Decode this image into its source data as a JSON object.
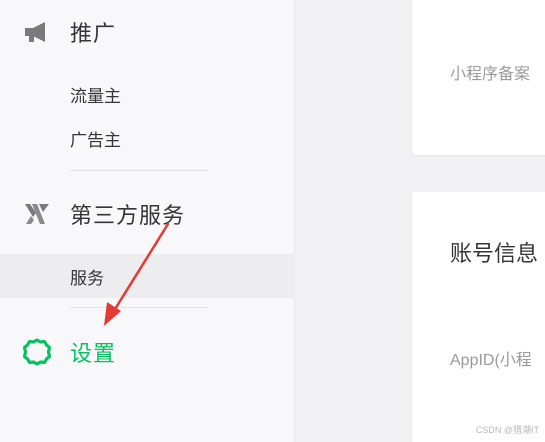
{
  "sidebar": {
    "promotion": {
      "label": "推广",
      "icon": "megaphone-icon",
      "items": [
        {
          "label": "流量主"
        },
        {
          "label": "广告主"
        }
      ]
    },
    "third_party": {
      "label": "第三方服务",
      "icon": "third-party-logo-icon",
      "items": [
        {
          "label": "服务",
          "selected": true
        }
      ]
    },
    "settings": {
      "label": "设置",
      "icon": "gear-icon",
      "active": true
    }
  },
  "main": {
    "filing_card": {
      "label": "小程序备案"
    },
    "account_card": {
      "title": "账号信息",
      "appid_label": "AppID(小程"
    }
  },
  "watermark": "CSDN @猎潮IT",
  "colors": {
    "accent": "#07c160",
    "annotation_arrow": "#e53935"
  }
}
